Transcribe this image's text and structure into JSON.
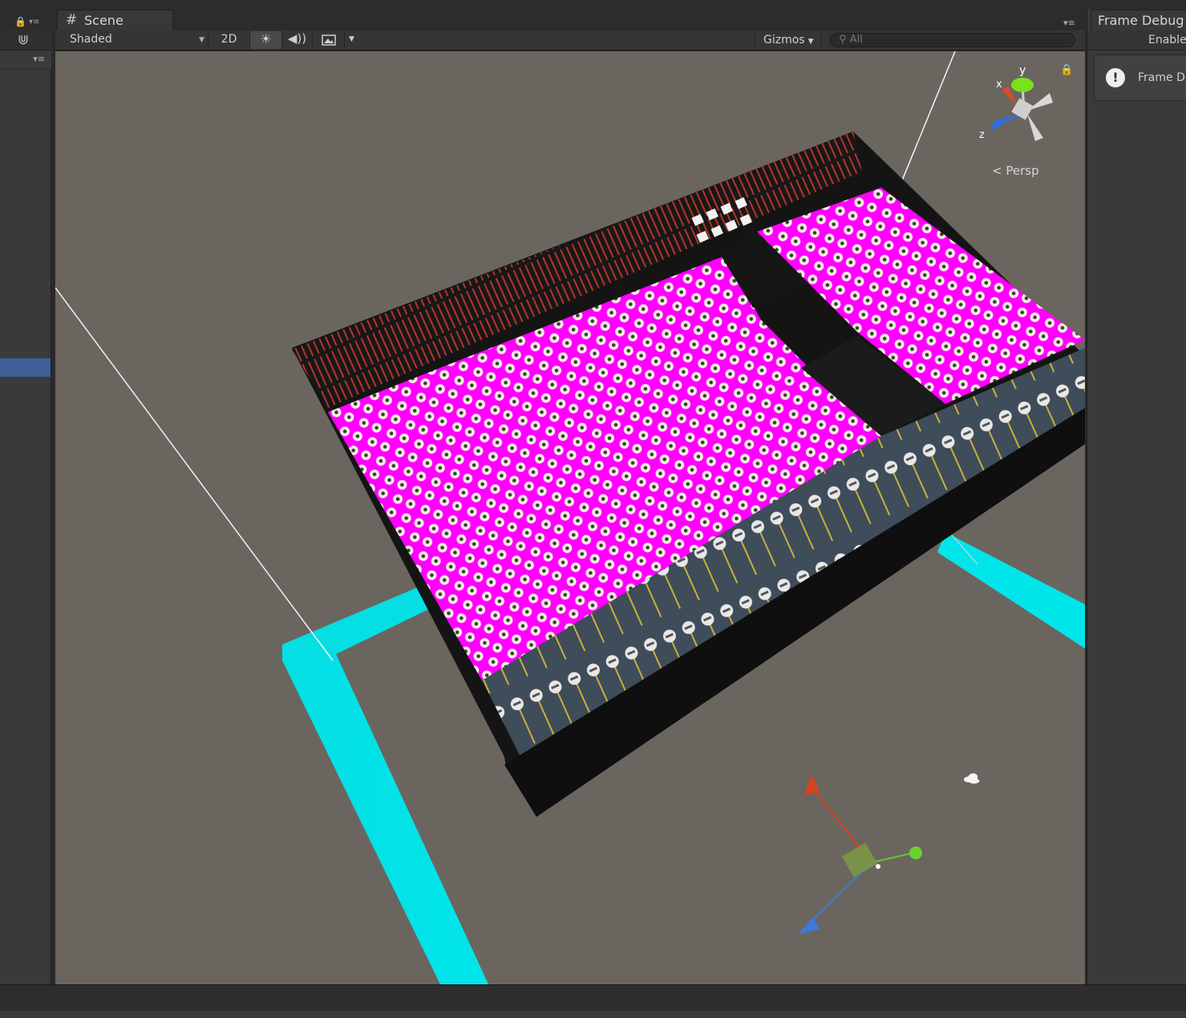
{
  "scene_tab": {
    "label": "Scene",
    "icon": "grid-icon"
  },
  "toolbar": {
    "draw_mode": "Shaded",
    "two_d": "2D",
    "lighting_icon": "sun-icon",
    "audio_icon": "speaker-icon",
    "effects_icon": "image-icon",
    "gizmos": "Gizmos",
    "search_placeholder": "All"
  },
  "viewport": {
    "projection": "Persp",
    "axes": {
      "x": "x",
      "y": "y",
      "z": "z"
    },
    "colors": {
      "background": "#6b655f",
      "board_pink": "#ff00ff",
      "frame_cyan": "#00e5ea",
      "fader_strip": "#3f4c5a",
      "console_body": "#141414"
    }
  },
  "frame_debugger": {
    "tab": "Frame Debug",
    "enable": "Enable",
    "message": "Frame D"
  }
}
